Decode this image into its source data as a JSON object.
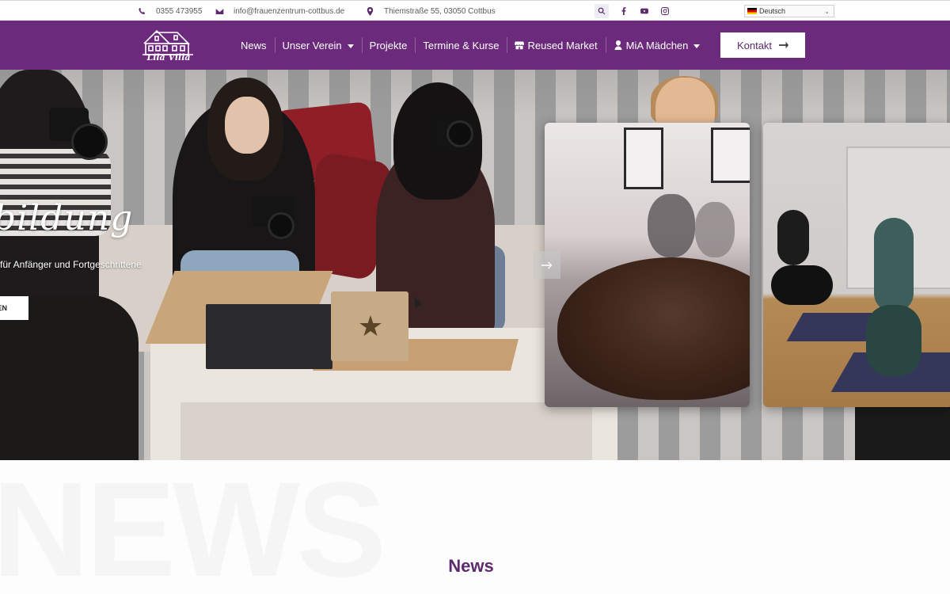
{
  "topbar": {
    "phone": "0355 473955",
    "email": "info@frauenzentrum-cottbus.de",
    "address": "Thiemstraße 55, 03050 Cottbus",
    "language": "Deutsch"
  },
  "nav": {
    "logo_text": "Lila Villa",
    "items": [
      {
        "label": "News"
      },
      {
        "label": "Unser Verein"
      },
      {
        "label": "Projekte"
      },
      {
        "label": "Termine & Kurse"
      },
      {
        "label": "Reused Market"
      },
      {
        "label": "MiA Mädchen"
      }
    ],
    "contact_label": "Kontakt"
  },
  "hero": {
    "title": "bildung",
    "subtitle": "für Anfänger und Fortgeschrittene",
    "button_label": "EN"
  },
  "news": {
    "title": "News",
    "background_text": "NEWS"
  },
  "colors": {
    "brand": "#6b2a7c",
    "brand_dark": "#5d2a6e",
    "white": "#ffffff"
  },
  "icons": [
    "phone-icon",
    "mail-icon",
    "map-pin-icon",
    "search-icon",
    "facebook-icon",
    "youtube-icon",
    "instagram-icon",
    "store-icon",
    "user-icon",
    "arrow-right-icon"
  ]
}
